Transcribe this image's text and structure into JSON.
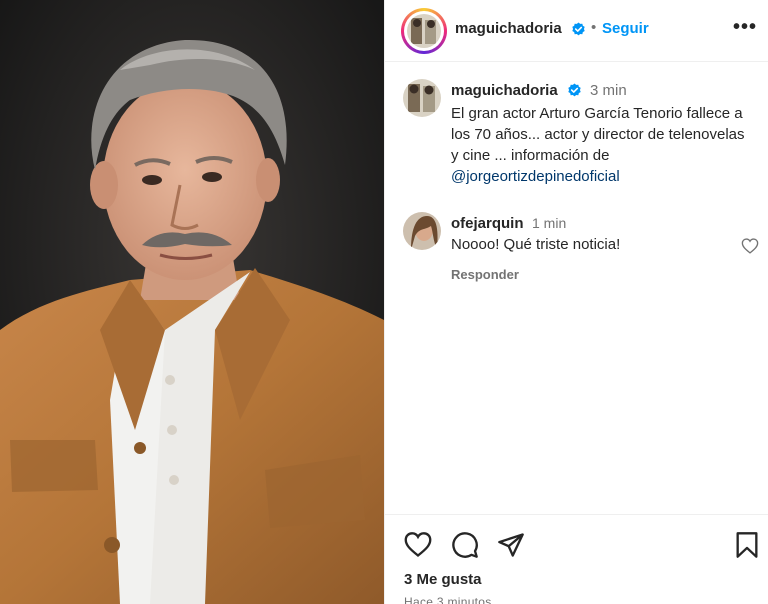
{
  "post": {
    "author": "maguichadoria",
    "follow_label": "Seguir",
    "separator": "•",
    "more_label": "•••",
    "caption_time": "3 min",
    "caption_text": "El gran actor Arturo García Tenorio fallece a los 70 años... actor y director de telenovelas y cine ... información de",
    "caption_mention": "@jorgeortizdepinedoficial"
  },
  "comment": {
    "author": "ofejarquin",
    "time": "1 min",
    "text": "Noooo! Qué triste noticia!",
    "reply_label": "Responder"
  },
  "footer": {
    "likes": "3 Me gusta",
    "time_ago": "Hace 3 minutos"
  },
  "icons": {
    "verified": "verified-badge-icon",
    "more": "more-options-icon",
    "like": "heart-icon",
    "comment": "comment-icon",
    "share": "share-icon",
    "save": "bookmark-icon"
  },
  "colors": {
    "follow": "#0095f6",
    "mention": "#00376b",
    "verified": "#0095f6"
  }
}
